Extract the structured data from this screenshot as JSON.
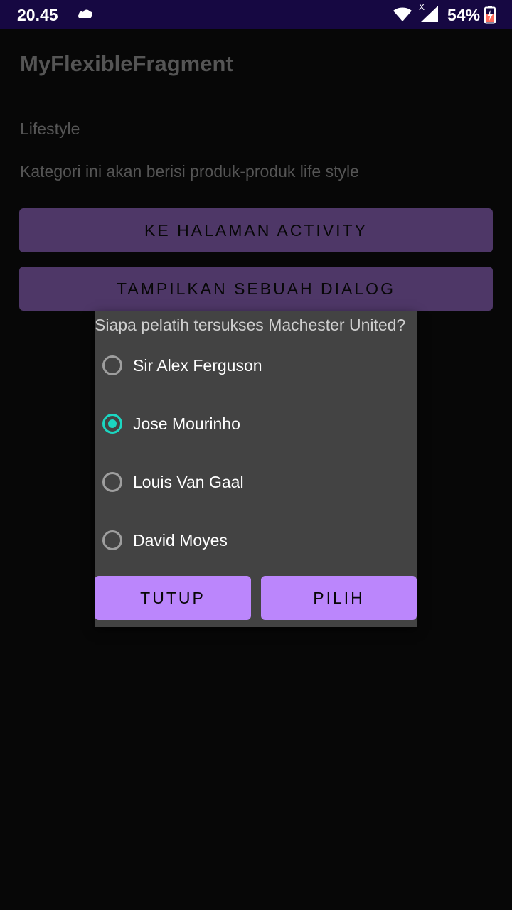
{
  "status_bar": {
    "time": "20.45",
    "cloud_icon": "cloud-icon",
    "wifi_icon": "wifi-icon",
    "signal_icon": "signal-icon",
    "signal_badge": "X",
    "battery_percent": "54%",
    "battery_icon": "battery-charging-icon"
  },
  "app": {
    "title": "MyFlexibleFragment"
  },
  "category": {
    "title": "Lifestyle",
    "description": "Kategori ini akan berisi produk-produk life style"
  },
  "buttons": {
    "to_activity": "KE HALAMAN ACTIVITY",
    "show_dialog": "TAMPILKAN SEBUAH DIALOG"
  },
  "dialog": {
    "question": "Siapa pelatih tersukses Machester United?",
    "options": [
      {
        "label": "Sir Alex Ferguson",
        "checked": false
      },
      {
        "label": "Jose Mourinho",
        "checked": true
      },
      {
        "label": "Louis Van Gaal",
        "checked": false
      },
      {
        "label": "David Moyes",
        "checked": false
      }
    ],
    "close_label": "TUTUP",
    "choose_label": "PILIH"
  },
  "colors": {
    "status_bar": "#160842",
    "background": "#070707",
    "dim_button": "#4e3767",
    "dialog_bg": "#434343",
    "accent_radio": "#1bd6c1",
    "dialog_button": "#bb86fc"
  }
}
